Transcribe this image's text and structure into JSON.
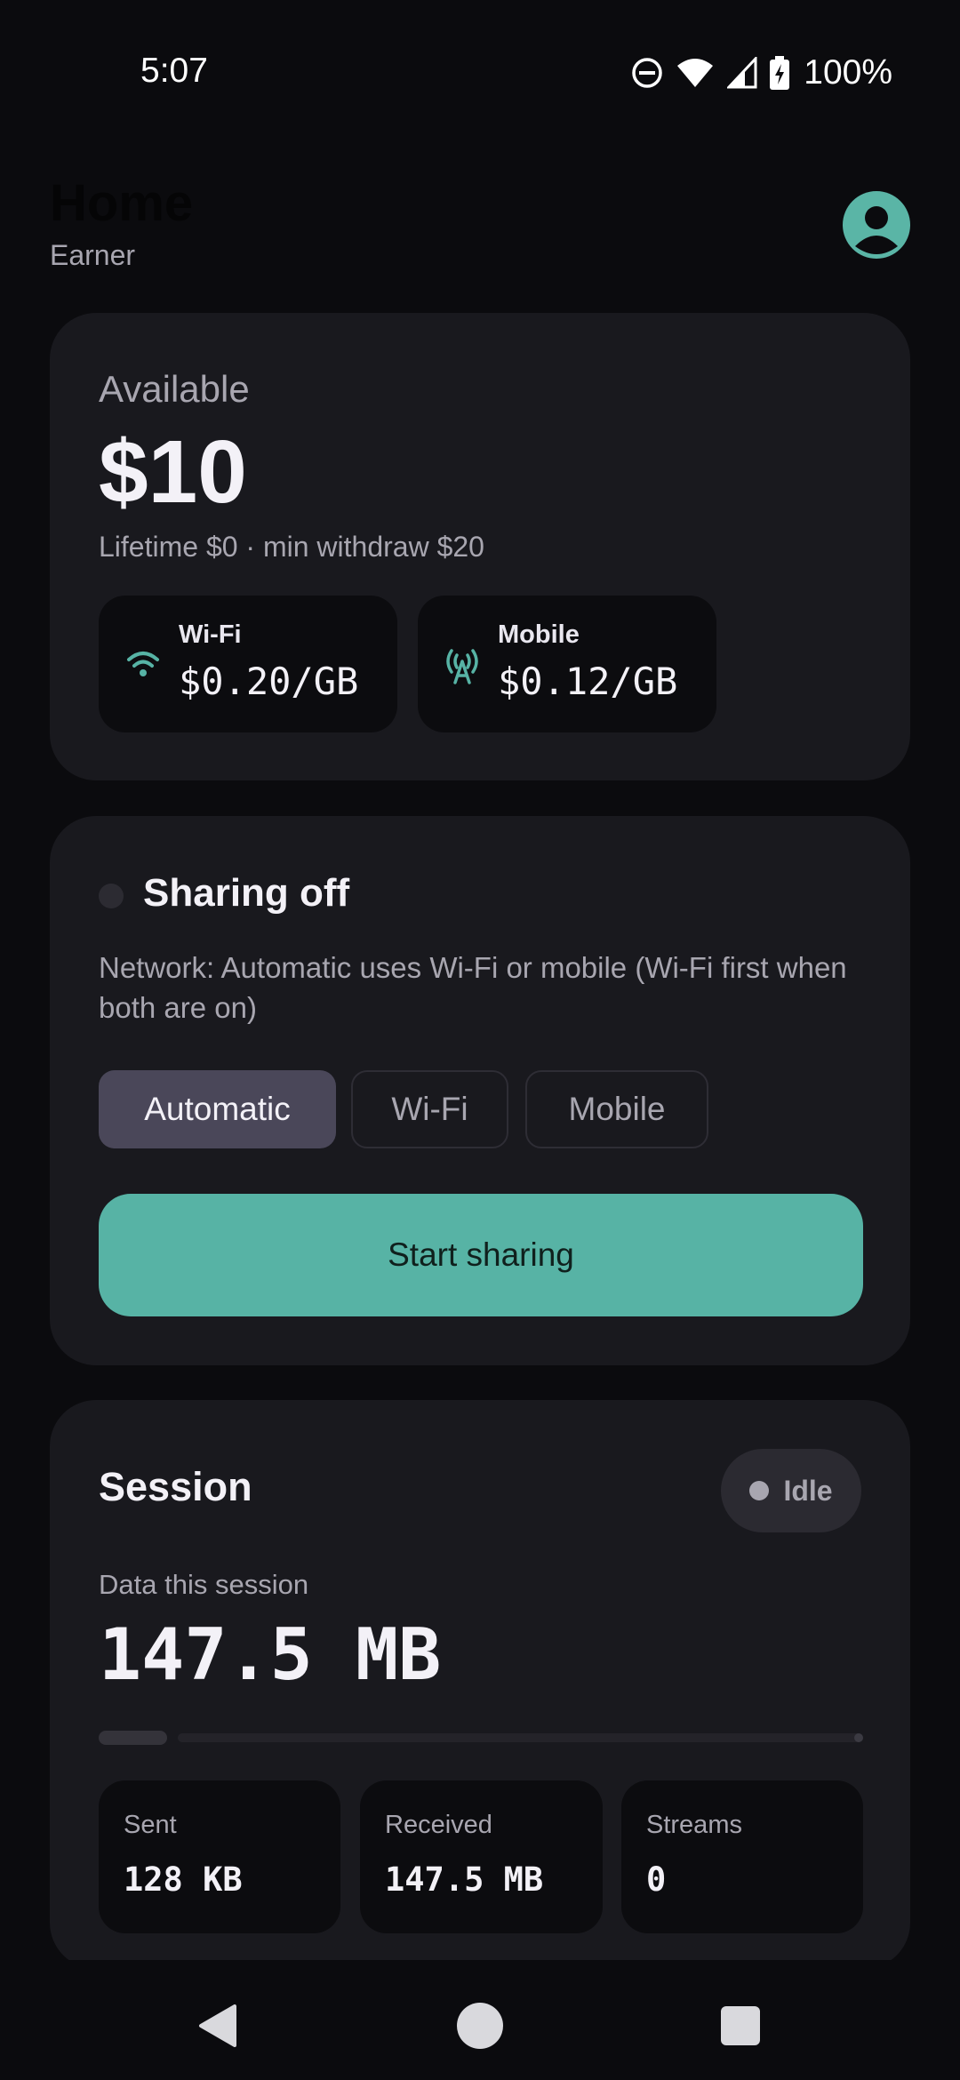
{
  "status_bar": {
    "time": "5:07",
    "battery_percent": "100%",
    "icons": [
      "do-not-disturb-icon",
      "wifi-signal-icon",
      "cell-signal-icon",
      "battery-charging-icon"
    ]
  },
  "header": {
    "title": "Home",
    "subtitle": "Earner",
    "avatar_icon": "account-circle-icon"
  },
  "balance": {
    "label": "Available",
    "amount": "$10",
    "meta": "Lifetime $0 · min withdraw $20",
    "rates": [
      {
        "name": "Wi-Fi",
        "price": "$0.20/GB",
        "icon": "wifi-icon"
      },
      {
        "name": "Mobile",
        "price": "$0.12/GB",
        "icon": "cell-tower-icon"
      }
    ]
  },
  "sharing": {
    "status": "Sharing off",
    "description": "Network: Automatic uses Wi-Fi or mobile (Wi-Fi first when both are on)",
    "options": [
      "Automatic",
      "Wi-Fi",
      "Mobile"
    ],
    "selected_option": "Automatic",
    "start_button": "Start sharing"
  },
  "session": {
    "title": "Session",
    "state": "Idle",
    "data_label": "Data this session",
    "data_value": "147.5 MB",
    "progress_fraction": 0.09,
    "stats": [
      {
        "label": "Sent",
        "value": "128 KB"
      },
      {
        "label": "Received",
        "value": "147.5 MB"
      },
      {
        "label": "Streams",
        "value": "0"
      }
    ]
  },
  "colors": {
    "accent": "#57b3a5",
    "background": "#0b0b0e",
    "card": "#19191e",
    "selected_segment": "#4a4759"
  }
}
